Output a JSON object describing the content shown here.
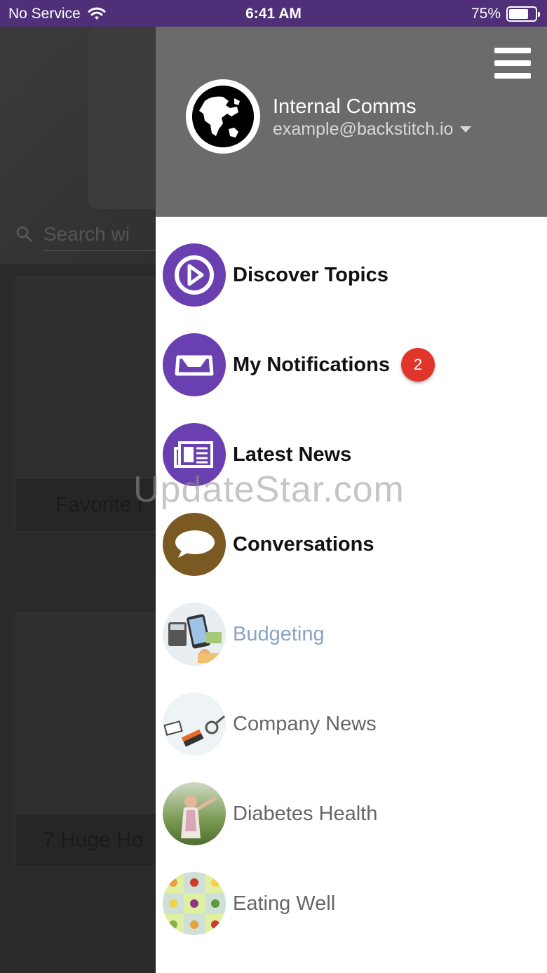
{
  "status_bar": {
    "carrier": "No Service",
    "time": "6:41 AM",
    "battery": "75%",
    "battery_level": 0.75
  },
  "background": {
    "search_placeholder": "Search wi",
    "cards": [
      {
        "title": "Favorite r"
      },
      {
        "title": "7 Huge Ho"
      }
    ]
  },
  "drawer": {
    "account": {
      "name": "Internal Comms",
      "email": "example@backstitch.io"
    },
    "items": [
      {
        "label": "Discover Topics",
        "icon": "compass-icon",
        "style": "bold"
      },
      {
        "label": "My Notifications",
        "icon": "inbox-icon",
        "style": "bold",
        "badge": "2"
      },
      {
        "label": "Latest News",
        "icon": "newspaper-icon",
        "style": "bold"
      },
      {
        "label": "Conversations",
        "icon": "chat-bubble-icon",
        "style": "bold"
      },
      {
        "label": "Budgeting",
        "icon": "budgeting-thumbnail",
        "style": "active"
      },
      {
        "label": "Company News",
        "icon": "company-news-thumbnail",
        "style": "normal"
      },
      {
        "label": "Diabetes Health",
        "icon": "diabetes-health-thumbnail",
        "style": "normal"
      },
      {
        "label": "Eating Well",
        "icon": "eating-well-thumbnail",
        "style": "normal"
      }
    ]
  },
  "watermark": "UpdateStar.com",
  "colors": {
    "status_bar": "#4f2f78",
    "menu_icon_purple": "#6a3fb0",
    "conversations_brown": "#7a5a22",
    "badge": "#e0352b",
    "drawer_header": "#6b6b6b"
  }
}
